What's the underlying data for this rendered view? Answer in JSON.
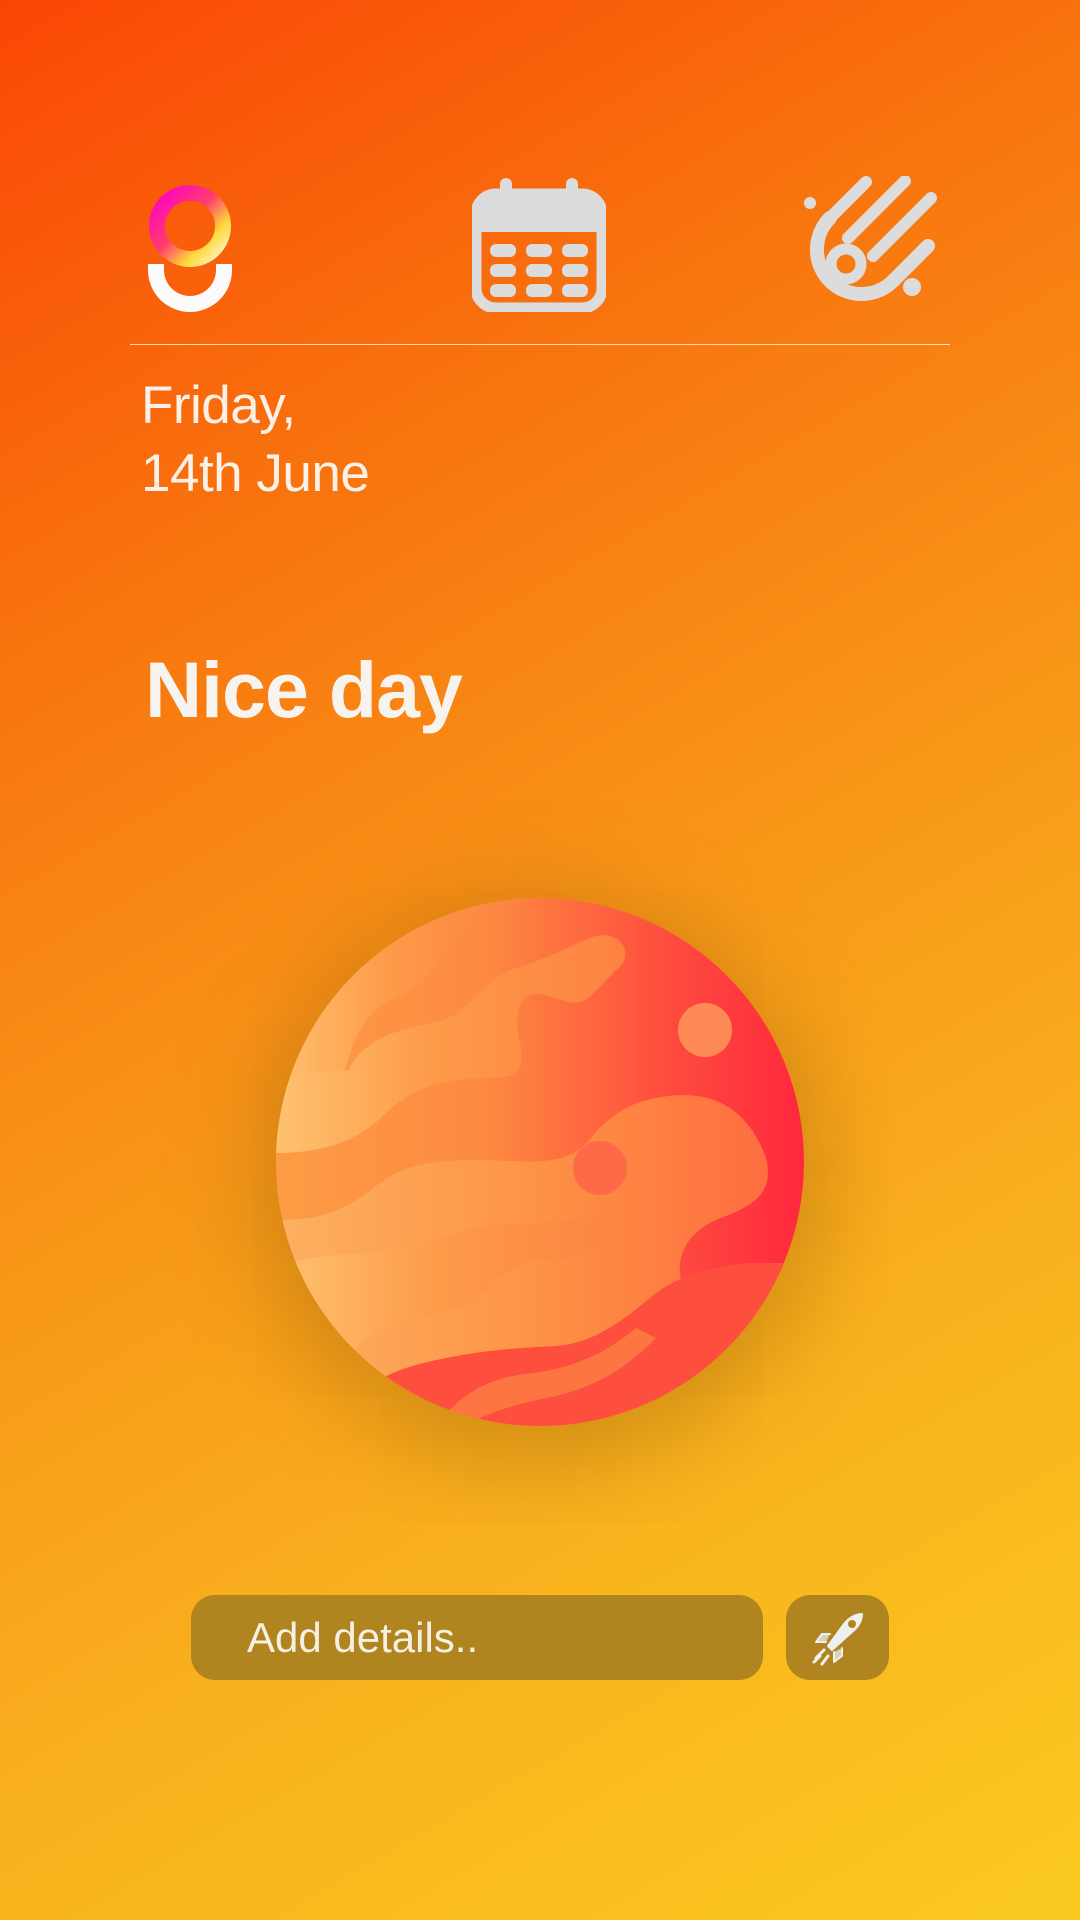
{
  "nav": {
    "items": [
      {
        "icon": "logo-icon",
        "label": ""
      },
      {
        "icon": "calendar-icon",
        "label": ""
      },
      {
        "icon": "meteor-icon",
        "label": ""
      }
    ]
  },
  "date": {
    "line1": "Friday,",
    "line2": "14th June"
  },
  "mood": {
    "title": "Nice day",
    "illustration": "planet-icon"
  },
  "composer": {
    "placeholder": "Add details..",
    "value": "",
    "send_icon": "rocket-icon"
  },
  "colors": {
    "background_start": "#fa4605",
    "background_end": "#fac91f",
    "text": "#fbf1e8",
    "field": "#b0851f",
    "icon": "#dcdcdc",
    "planet_red": "#fe2d3c",
    "planet_orange": "#fd9a44"
  }
}
